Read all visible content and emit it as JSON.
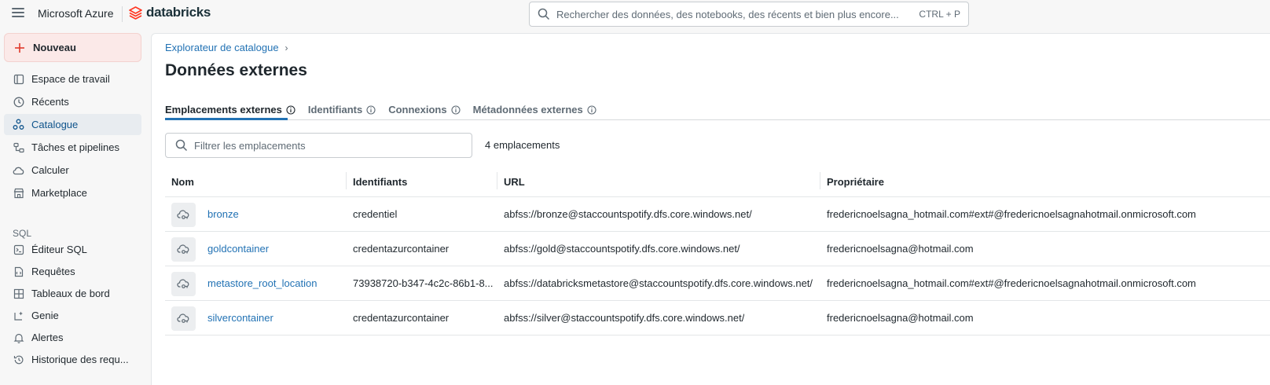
{
  "header": {
    "app_title": "Microsoft Azure",
    "brand": "databricks",
    "search_placeholder": "Rechercher des données, des notebooks, des récents et bien plus encore...",
    "search_shortcut": "CTRL + P"
  },
  "sidebar": {
    "new_label": "Nouveau",
    "items": [
      {
        "label": "Espace de travail",
        "icon": "workspace-icon"
      },
      {
        "label": "Récents",
        "icon": "clock-icon"
      },
      {
        "label": "Catalogue",
        "icon": "catalog-icon",
        "active": true
      },
      {
        "label": "Tâches et pipelines",
        "icon": "workflows-icon"
      },
      {
        "label": "Calculer",
        "icon": "cloud-icon"
      },
      {
        "label": "Marketplace",
        "icon": "store-icon"
      }
    ],
    "sql_section": "SQL",
    "sql_items": [
      {
        "label": "Éditeur SQL",
        "icon": "sql-editor-icon"
      },
      {
        "label": "Requêtes",
        "icon": "query-icon"
      },
      {
        "label": "Tableaux de bord",
        "icon": "dashboard-icon"
      },
      {
        "label": "Genie",
        "icon": "genie-icon"
      },
      {
        "label": "Alertes",
        "icon": "bell-icon"
      },
      {
        "label": "Historique des requ...",
        "icon": "history-icon"
      }
    ]
  },
  "main": {
    "breadcrumb": "Explorateur de catalogue",
    "title": "Données externes",
    "tabs": [
      {
        "label": "Emplacements externes",
        "active": true
      },
      {
        "label": "Identifiants"
      },
      {
        "label": "Connexions"
      },
      {
        "label": "Métadonnées externes"
      }
    ],
    "filter_placeholder": "Filtrer les emplacements",
    "count": "4 emplacements",
    "columns": [
      "Nom",
      "Identifiants",
      "URL",
      "Propriétaire"
    ],
    "rows": [
      {
        "name": "bronze",
        "credential": "credentiel",
        "url": "abfss://bronze@staccountspotify.dfs.core.windows.net/",
        "owner": "fredericnoelsagna_hotmail.com#ext#@fredericnoelsagnahotmail.onmicrosoft.com"
      },
      {
        "name": "goldcontainer",
        "credential": "credentazurcontainer",
        "url": "abfss://gold@staccountspotify.dfs.core.windows.net/",
        "owner": "fredericnoelsagna@hotmail.com"
      },
      {
        "name": "metastore_root_location",
        "credential": "73938720-b347-4c2c-86b1-8...",
        "url": "abfss://databricksmetastore@staccountspotify.dfs.core.windows.net/",
        "owner": "fredericnoelsagna_hotmail.com#ext#@fredericnoelsagnahotmail.onmicrosoft.com"
      },
      {
        "name": "silvercontainer",
        "credential": "credentazurcontainer",
        "url": "abfss://silver@staccountspotify.dfs.core.windows.net/",
        "owner": "fredericnoelsagna@hotmail.com"
      }
    ]
  }
}
